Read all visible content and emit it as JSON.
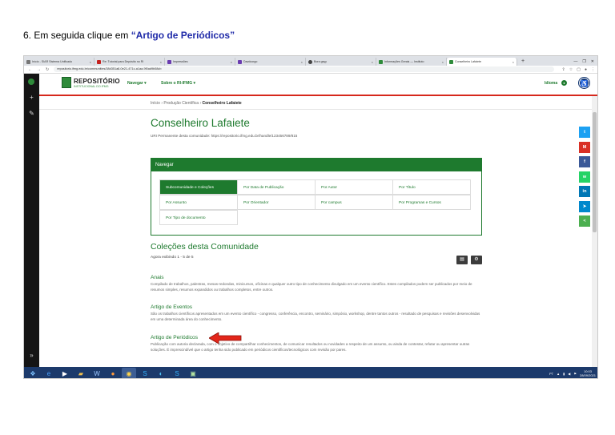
{
  "instruction": {
    "prefix": "6. Em seguida clique em ",
    "highlight": "“Artigo de Periódicos”"
  },
  "browser": {
    "tabs": [
      {
        "label": "Início - SIAR Sistema Unificado"
      },
      {
        "label": "Re: Tutorial para Depósito no RI"
      },
      {
        "label": "Impressões"
      },
      {
        "label": "Davdcorgo"
      },
      {
        "label": "Bora gsyy"
      },
      {
        "label": "Informações Gerais — Instituto"
      },
      {
        "label": "Conselheiro Lafaiete"
      }
    ],
    "url": "repositorio.ifmg.edu.br/communities/38d351a8-0e21-471c-a1aa-9f0ad9b58cb"
  },
  "header": {
    "logo_title": "REPOSITÓRIO",
    "logo_subtitle": "INSTITUCIONAL DO IFMG",
    "nav_navigate": "Navegar ▾",
    "nav_about": "Sobre o RI-IFMG ▾",
    "language": "Idioma"
  },
  "breadcrumb": {
    "home": "Início",
    "section": "Produção Científica",
    "current": "Conselheiro Lafaiete",
    "sep": "›"
  },
  "community": {
    "title": "Conselheiro Lafaiete",
    "uri": "URI Permanente desta comunidade: https://repositorio.ifmg.edu.br/handle/123456789/815"
  },
  "navigate_panel": {
    "heading": "Navegar",
    "rows": [
      [
        "Subcomunidade e Coleções",
        "Por Data de Publicação",
        "Por Autor",
        "Por Título"
      ],
      [
        "Por Assunto",
        "Por Orientador",
        "Por campus",
        "Por Programas e Cursos"
      ],
      [
        "Por Tipo de documento"
      ]
    ]
  },
  "collections": {
    "title": "Coleções desta Comunidade",
    "count": "Agora exibindo 1 - 5 de 5",
    "items": [
      {
        "title": "Anais",
        "description": "Compilado de trabalhos, palestras, mesas-redondas, minicursos, oficinas e qualquer outro tipo de conhecimento divulgado em um evento científico. Estes compilados podem ser publicados por meio de resumos simples, resumos expandidos ou trabalhos completos, entre outros."
      },
      {
        "title": "Artigo de Eventos",
        "description": "São os trabalhos científicos apresentados em um evento científico - congresso, conferência, encontro, seminário, simpósio, workshop, dentre tantos outros - resultado de pesquisas e revisões desenvolvidas em uma determinada área do conhecimento."
      },
      {
        "title": "Artigo de Periódicos",
        "description": "Publicação com autoria declarada, com o objetivo de compartilhar conhecimentos, de comunicar resultados ou novidades a respeito de um assunto, ou ainda de contestar, refutar ou apresentar outras soluções. É imprescindível que o artigo tenha sido publicado em periódicos científicos/tecnológicos com revisão por pares."
      }
    ]
  },
  "social": [
    {
      "name": "twitter",
      "glyph": "t",
      "color": "#1da1f2"
    },
    {
      "name": "gmail",
      "glyph": "M",
      "color": "#d93025"
    },
    {
      "name": "facebook",
      "glyph": "f",
      "color": "#3b5998"
    },
    {
      "name": "whatsapp",
      "glyph": "w",
      "color": "#25d366"
    },
    {
      "name": "linkedin",
      "glyph": "in",
      "color": "#0077b5"
    },
    {
      "name": "telegram",
      "glyph": "➤",
      "color": "#0088cc"
    },
    {
      "name": "share",
      "glyph": "<",
      "color": "#4caf50"
    }
  ],
  "taskbar": {
    "tray_lang": "PT",
    "time": "10:03",
    "date": "28/09/2021"
  },
  "colors": {
    "green": "#1e7a2e",
    "red_accent": "#d6281c",
    "instruction_highlight": "#1f2aa8"
  }
}
